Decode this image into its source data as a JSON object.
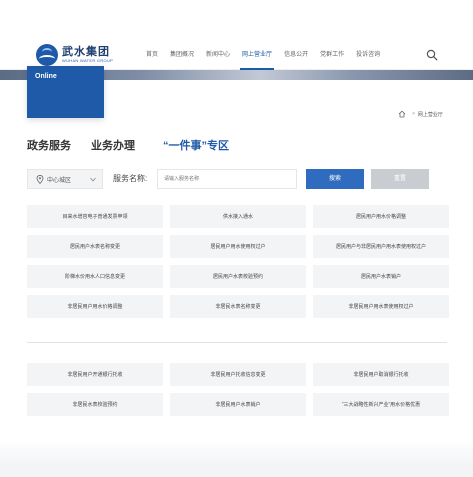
{
  "header": {
    "logo_cn": "武水集团",
    "logo_en": "WUHAN WATER GROUP",
    "nav": [
      {
        "label": "首页",
        "active": false
      },
      {
        "label": "集团概况",
        "active": false
      },
      {
        "label": "新闻中心",
        "active": false
      },
      {
        "label": "网上营业厅",
        "active": true
      },
      {
        "label": "信息公开",
        "active": false
      },
      {
        "label": "党群工作",
        "active": false
      },
      {
        "label": "投诉咨询",
        "active": false
      }
    ]
  },
  "banner": {
    "label": "Online"
  },
  "breadcrumb": {
    "current": "网上营业厅"
  },
  "tabs": [
    {
      "label": "政务服务"
    },
    {
      "label": "业务办理"
    },
    {
      "label": "“一件事”专区"
    }
  ],
  "filter": {
    "region": "中心城区",
    "service_label": "服务名称:",
    "service_placeholder": "请输入服务名称",
    "search_button": "搜索",
    "reset_button": "重置"
  },
  "services_group1": [
    "目来水增容电子普通发票申领",
    "供水接入通水",
    "居民用户用水价格调整",
    "居民用户水表名称变更",
    "居民用户用水使用权过户",
    "居民用户与非居民用户用水表使用权过户",
    "阶梯水价用水人口信息变更",
    "居民用户水表校验预约",
    "居民用户水表销户",
    "非居民用户用水价格调整",
    "非居民水表名称变更",
    "非居民用户用水表使用权过户"
  ],
  "services_group2": [
    "非居民用户开通银行托收",
    "非居民用户托收信息变更",
    "非居民用户取消银行托收",
    "非居民水表校验预约",
    "非居民用户水表销户",
    "“三大战略性新兴产业”用水价格优惠"
  ],
  "colors": {
    "accent": "#1f5aa8",
    "button_primary": "#2f6cbf",
    "button_secondary": "#c9ccd1"
  }
}
